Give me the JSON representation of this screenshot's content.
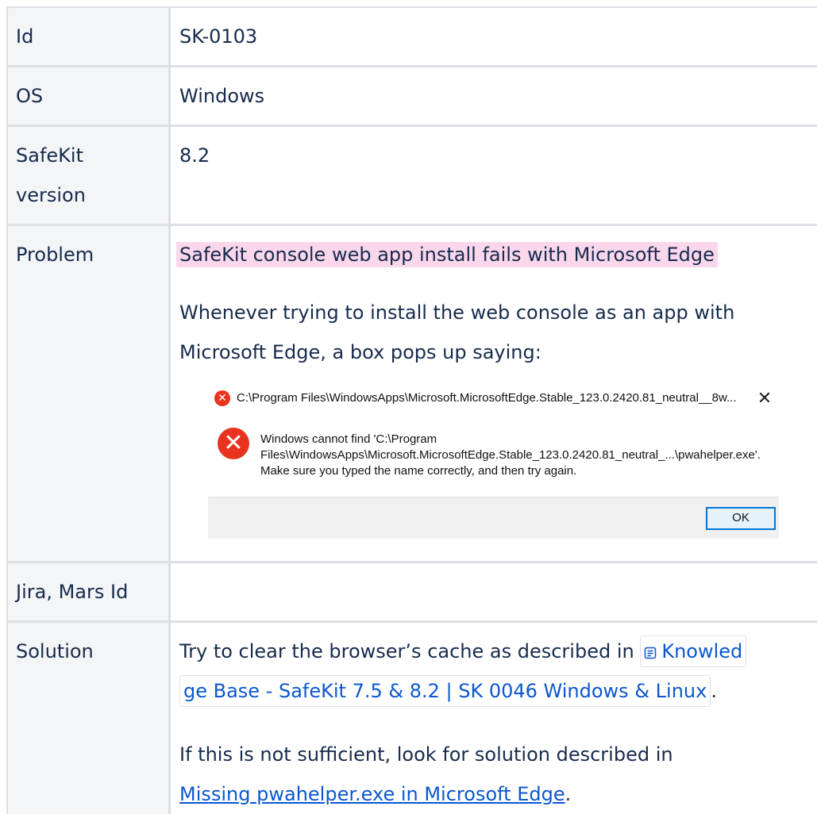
{
  "rows": {
    "id": {
      "label": "Id",
      "value": "SK-0103"
    },
    "os": {
      "label": "OS",
      "value": "Windows"
    },
    "version": {
      "label_line1": "SafeKit",
      "label_line2": "version",
      "value": "8.2"
    },
    "problem": {
      "label": "Problem",
      "highlight": "SafeKit console web app install fails with Microsoft Edge",
      "desc_line1": "Whenever trying to install the web console as an app with",
      "desc_line2": "Microsoft Edge, a box pops up saying:"
    },
    "jira": {
      "label": "Jira, Mars Id",
      "value": ""
    },
    "solution": {
      "label": "Solution",
      "line1_prefix": "Try to clear the browser’s cache as described in ",
      "kb_part1": "Knowled",
      "kb_part2": "ge Base - SafeKit 7.5  & 8.2 | SK 0046   Windows & Linux",
      "line2_suffix": ".",
      "line3": "If this is not sufficient, look for solution described in",
      "link_text": "Missing pwahelper.exe in Microsoft Edge",
      "link_suffix": "."
    }
  },
  "dialog": {
    "title": "C:\\Program Files\\WindowsApps\\Microsoft.MicrosoftEdge.Stable_123.0.2420.81_neutral__8w...",
    "close_glyph": "✕",
    "message_line1": "Windows cannot find 'C:\\Program",
    "message_line2": "Files\\WindowsApps\\Microsoft.MicrosoftEdge.Stable_123.0.2420.81_neutral_...\\pwahelper.exe'.",
    "message_line3": "Make sure you typed the name correctly, and then try again.",
    "ok_label": "OK",
    "error_glyph": "✕"
  },
  "icons": {
    "error": "error-icon",
    "close": "close-icon",
    "page": "page-icon"
  },
  "colors": {
    "border": "#dcdfe4",
    "header_bg": "#f4f5f7",
    "highlight": "#fbd7ec",
    "link": "#0b57d0",
    "error_red": "#e8341e"
  }
}
